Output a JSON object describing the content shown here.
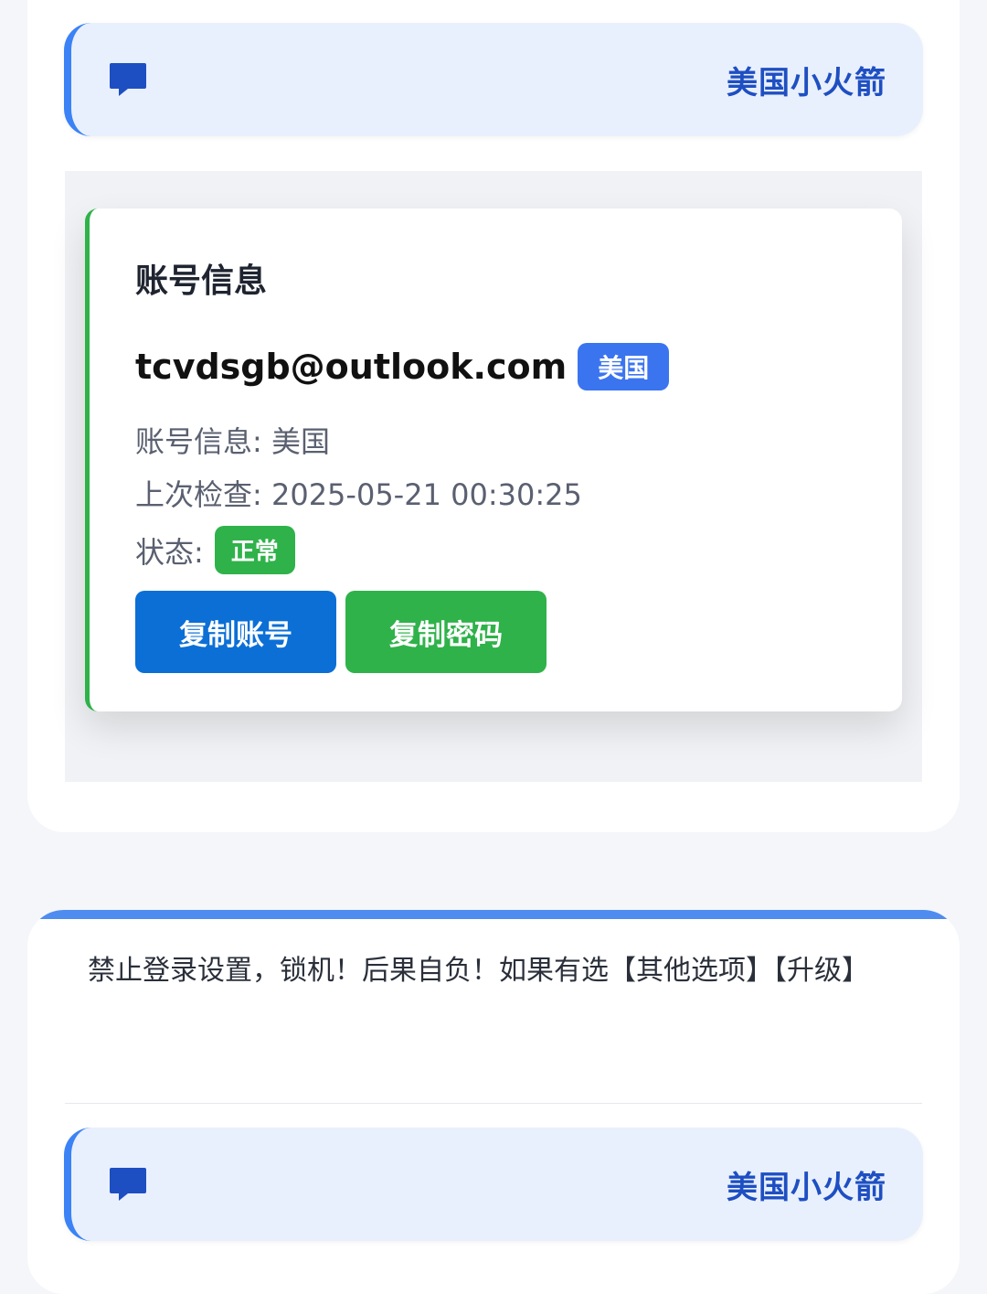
{
  "product_headers": [
    {
      "title": "美国小火箭",
      "icon": "chat-bubble-icon"
    },
    {
      "title": "美国小火箭",
      "icon": "chat-bubble-icon"
    }
  ],
  "account_card": {
    "title": "账号信息",
    "email": "tcvdsgb@outlook.com",
    "region_badge": "美国",
    "info_label": "账号信息:",
    "info_value": "美国",
    "last_check_label": "上次检查:",
    "last_check_value": "2025-05-21 00:30:25",
    "status_label": "状态:",
    "status_value": "正常",
    "copy_account_label": "复制账号",
    "copy_password_label": "复制密码"
  },
  "notice": {
    "text": "禁止登录设置，锁机！后果自负！如果有选【其他选项】【升级】"
  },
  "colors": {
    "accent_blue": "#3b82f6",
    "title_blue": "#1e4fc2",
    "success_green": "#2fb24a",
    "button_blue": "#0b6fd6"
  }
}
